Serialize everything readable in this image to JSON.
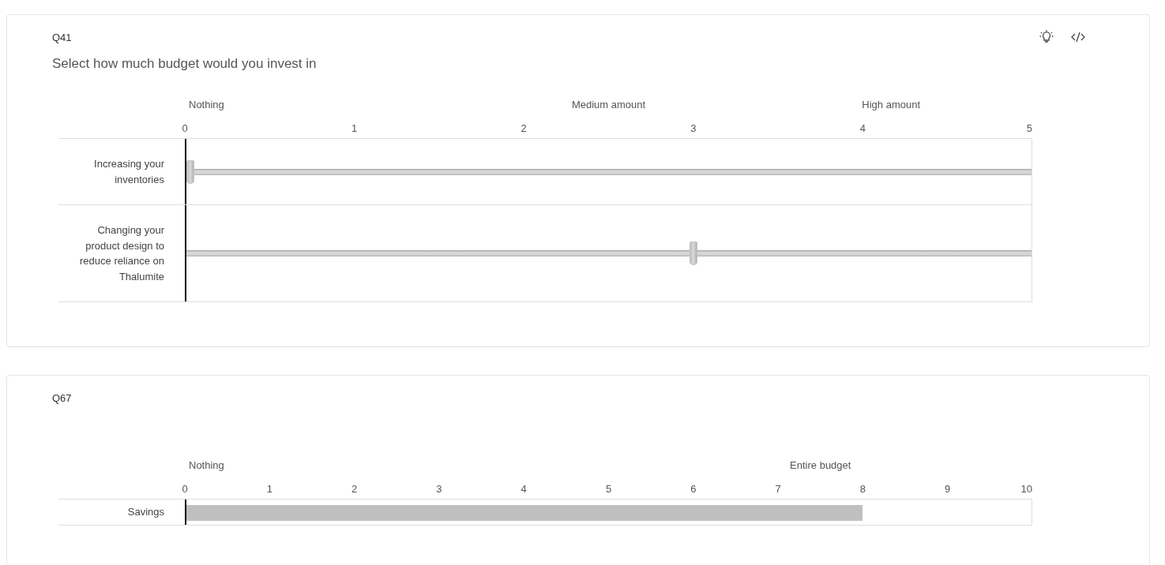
{
  "questions": [
    {
      "number": "Q41",
      "title": "Select how much budget would you invest in",
      "kind": "slider",
      "tools": [
        {
          "kind": "lightbulb"
        },
        {
          "kind": "code"
        }
      ],
      "scale_labels": [
        "Nothing",
        "Medium amount",
        "High amount"
      ],
      "ticks": [
        "0",
        "1",
        "2",
        "3",
        "4",
        "5"
      ],
      "rows": [
        {
          "label": "Increasing your inventories",
          "level": 0.005
        },
        {
          "label": "Changing your product design to reduce reliance on Thalumite",
          "level": 0.6
        }
      ]
    },
    {
      "number": "Q67",
      "kind": "bar",
      "scale_labels": [
        "Nothing",
        "Entire budget"
      ],
      "ticks": [
        "0",
        "1",
        "2",
        "3",
        "4",
        "5",
        "6",
        "7",
        "8",
        "9",
        "10"
      ],
      "rows": [
        {
          "label": "Savings",
          "level": 0.8
        }
      ]
    }
  ]
}
